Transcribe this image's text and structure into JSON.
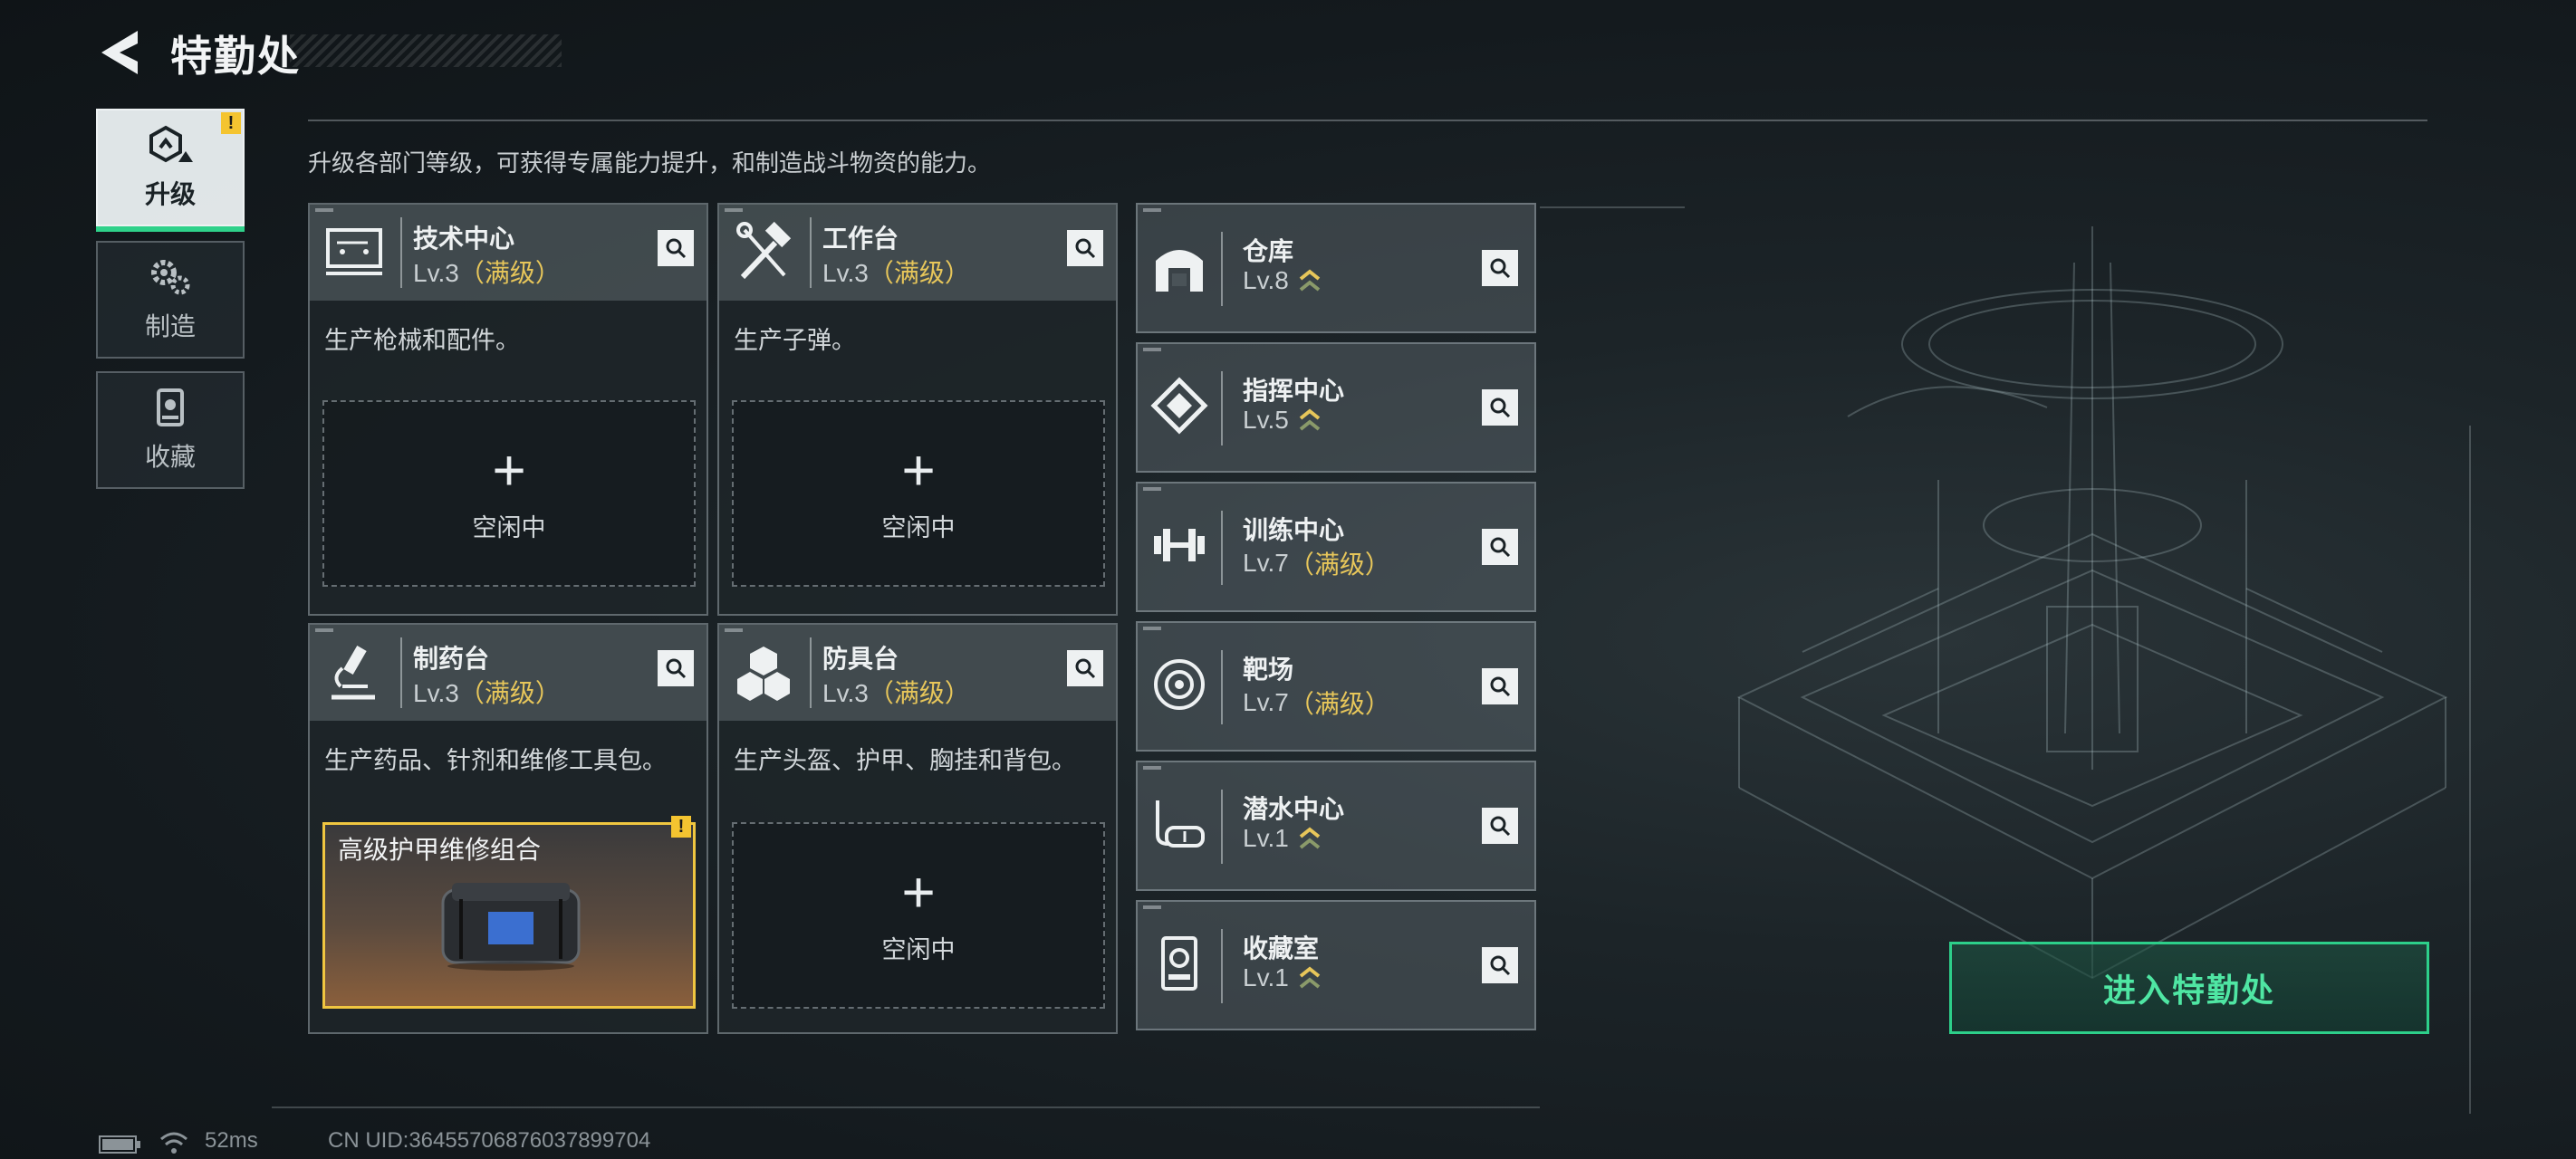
{
  "header": {
    "title": "特勤处"
  },
  "nav": [
    {
      "label": "升级",
      "alert": "!"
    },
    {
      "label": "制造"
    },
    {
      "label": "收藏"
    }
  ],
  "description": "升级各部门等级，可获得专属能力提升，和制造战斗物资的能力。",
  "workshops": [
    {
      "name": "技术中心",
      "level": "Lv.3",
      "max": "（满级）",
      "text": "生产枪械和配件。",
      "status": "空闲中"
    },
    {
      "name": "工作台",
      "level": "Lv.3",
      "max": "（满级）",
      "text": "生产子弹。",
      "status": "空闲中"
    },
    {
      "name": "制药台",
      "level": "Lv.3",
      "max": "（满级）",
      "text": "生产药品、针剂和维修工具包。",
      "crafting": {
        "item": "高级护甲维修组合",
        "alert": "!"
      }
    },
    {
      "name": "防具台",
      "level": "Lv.3",
      "max": "（满级）",
      "text": "生产头盔、护甲、胸挂和背包。",
      "status": "空闲中"
    }
  ],
  "facilities": [
    {
      "name": "仓库",
      "level": "Lv.8",
      "upgradable": true
    },
    {
      "name": "指挥中心",
      "level": "Lv.5",
      "upgradable": true
    },
    {
      "name": "训练中心",
      "level": "Lv.7",
      "max": "（满级）"
    },
    {
      "name": "靶场",
      "level": "Lv.7",
      "max": "（满级）"
    },
    {
      "name": "潜水中心",
      "level": "Lv.1",
      "upgradable": true
    },
    {
      "name": "收藏室",
      "level": "Lv.1",
      "upgradable": true
    }
  ],
  "enter_button": "进入特勤处",
  "footer": {
    "ping": "52ms",
    "uid": "CN UID:3645570687603789​9704"
  },
  "colors": {
    "accent_green": "#2dcf8a",
    "max_gold": "#e7c65a",
    "alert_yellow": "#f4c430"
  }
}
